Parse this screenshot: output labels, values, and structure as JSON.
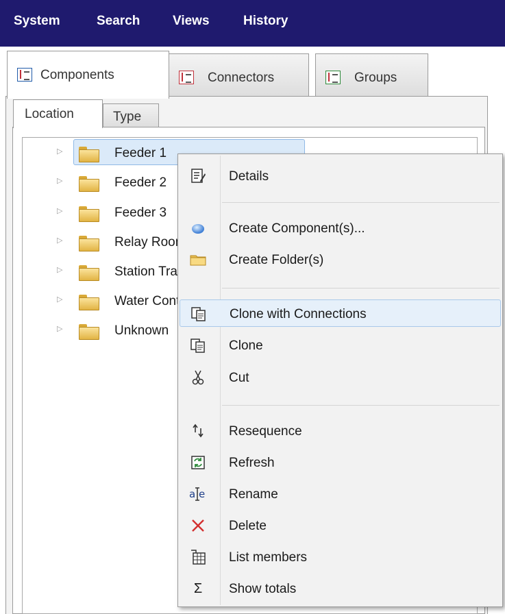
{
  "menubar": {
    "items": [
      "System",
      "Search",
      "Views",
      "History"
    ],
    "background": "#1f1a6e"
  },
  "outer_tabs": [
    {
      "label": "Components",
      "active": true,
      "icon": "tree-view-icon"
    },
    {
      "label": "Connectors",
      "active": false,
      "icon": "tree-view-icon"
    },
    {
      "label": "Groups",
      "active": false,
      "icon": "tree-view-icon"
    }
  ],
  "inner_tabs": [
    {
      "label": "Location",
      "active": true
    },
    {
      "label": "Type",
      "active": false
    }
  ],
  "tree": {
    "items": [
      {
        "label": "Feeder 1",
        "selected": true
      },
      {
        "label": "Feeder 2"
      },
      {
        "label": "Feeder 3"
      },
      {
        "label": "Relay Room"
      },
      {
        "label": "Station Transformers"
      },
      {
        "label": "Water Control"
      },
      {
        "label": "Unknown"
      }
    ]
  },
  "context_menu": {
    "items": [
      {
        "label": "Details",
        "icon": "details-icon"
      },
      {
        "label": "Create Component(s)...",
        "icon": "component-icon"
      },
      {
        "label": "Create Folder(s)",
        "icon": "folder-icon"
      },
      {
        "label": "Clone with Connections",
        "icon": "clone-icon",
        "highlighted": true
      },
      {
        "label": "Clone",
        "icon": "clone-icon"
      },
      {
        "label": "Cut",
        "icon": "scissors-icon"
      },
      {
        "label": "Resequence",
        "icon": "resequence-icon"
      },
      {
        "label": "Refresh",
        "icon": "refresh-icon"
      },
      {
        "label": "Rename",
        "icon": "rename-icon"
      },
      {
        "label": "Delete",
        "icon": "delete-icon"
      },
      {
        "label": "List members",
        "icon": "list-members-icon"
      },
      {
        "label": "Show totals",
        "icon": "sigma-icon"
      }
    ]
  }
}
